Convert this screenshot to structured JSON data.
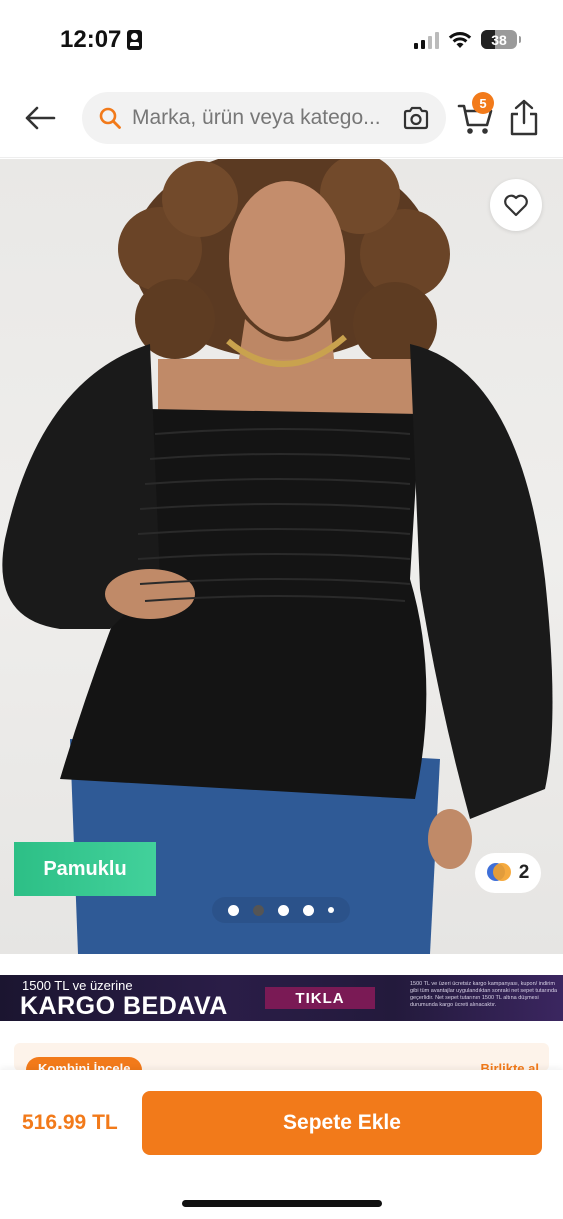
{
  "status_bar": {
    "time": "12:07",
    "battery": "38",
    "battery_level": 0.38
  },
  "header": {
    "search_placeholder": "Marka, ürün veya katego...",
    "cart_count": "5"
  },
  "product": {
    "tag": "Pamuklu",
    "color_count": "2",
    "carousel": {
      "total": 5,
      "active_index": 1
    }
  },
  "promo": {
    "small_text": "1500 TL ve üzerine",
    "big_text": "KARGO BEDAVA",
    "button_label": "TIKLA",
    "fine_print": "1500 TL ve üzeri ücretsiz kargo kampanyası, kupon/ indirim gibi tüm avantajlar uygulandıktan sonraki net sepet tutarında geçerlidir. Net sepet tutarının 1500 TL altına düşmesi durumunda kargo ücreti alınacaktır."
  },
  "combine": {
    "label": "Kombini İncele",
    "link": "Birlikte al"
  },
  "bottom_bar": {
    "price": "516.99 TL",
    "button_label": "Sepete Ekle"
  },
  "colors": {
    "accent": "#f27a1a",
    "tag_green": "#2dbf86"
  }
}
